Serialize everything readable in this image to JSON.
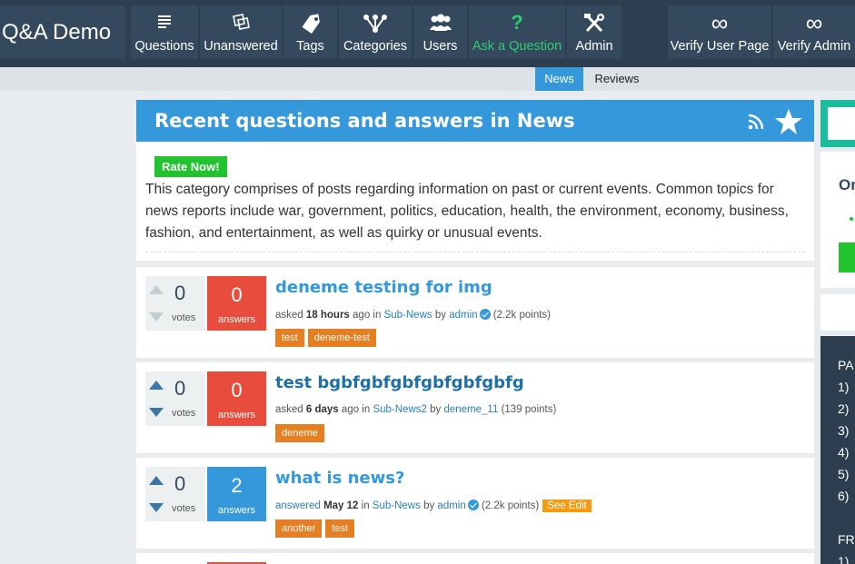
{
  "site": {
    "title": "Q&A Demo"
  },
  "nav": {
    "items": [
      {
        "label": "Questions",
        "icon": "list-icon"
      },
      {
        "label": "Unanswered",
        "icon": "unanswered-icon"
      },
      {
        "label": "Tags",
        "icon": "tag-icon"
      },
      {
        "label": "Categories",
        "icon": "categories-icon"
      },
      {
        "label": "Users",
        "icon": "users-icon"
      },
      {
        "label": "Ask a Question",
        "icon": "question-mark-icon"
      },
      {
        "label": "Admin",
        "icon": "tools-icon"
      },
      {
        "label": "Verify User Page",
        "icon": "infinity-icon"
      },
      {
        "label": "Verify Admin",
        "icon": "infinity-icon"
      }
    ],
    "ask_color": "#2ecc71"
  },
  "subnav": {
    "tabs": [
      {
        "label": "News",
        "active": true
      },
      {
        "label": "Reviews",
        "active": false
      }
    ]
  },
  "category": {
    "heading": "Recent questions and answers in News",
    "rate_button": "Rate Now!",
    "description": "This category comprises of posts regarding information on past or current events. Common topics for news reports include war, government, politics, education, health, the environment, economy, business, fashion, and entertainment, as well as quirky or unusual events."
  },
  "questions": [
    {
      "title": "deneme testing for img",
      "votes": "0",
      "votes_label": "votes",
      "answers": "0",
      "answers_label": "answers",
      "verb": "asked",
      "when": "18 hours",
      "when_suffix": "ago in",
      "category": "Sub-News",
      "by": "by",
      "user": "admin",
      "points": "(2.2k points)",
      "tags": [
        "test",
        "deneme-test"
      ]
    },
    {
      "title": "test bgbfgbfgbfgbfgbfgbfg",
      "votes": "0",
      "votes_label": "votes",
      "answers": "0",
      "answers_label": "answers",
      "verb": "asked",
      "when": "6 days",
      "when_suffix": "ago in",
      "category": "Sub-News2",
      "by": "by",
      "user": "deneme_11",
      "points": "(139 points)",
      "tags": [
        "deneme"
      ]
    },
    {
      "title": "what is news?",
      "votes": "0",
      "votes_label": "votes",
      "answers": "2",
      "answers_label": "answers",
      "verb": "answered",
      "when": "May 12",
      "when_suffix": "in",
      "category": "Sub-News",
      "by": "by",
      "user": "admin",
      "points": "(2.2k points)",
      "extra": "See Edit",
      "tags": [
        "another",
        "test"
      ]
    }
  ],
  "sidebar": {
    "widget_text": "Or",
    "panel_lines": [
      "PA",
      "1)",
      "2)",
      "3)",
      "4)",
      "5)",
      "6)",
      "FR",
      "1)"
    ]
  },
  "colors": {
    "topbar": "#2c3e50",
    "nav_button": "#34495e",
    "primary": "#3498db",
    "zero_answers": "#e74c3c",
    "tag": "#e67e22",
    "rate": "#21c42e"
  }
}
